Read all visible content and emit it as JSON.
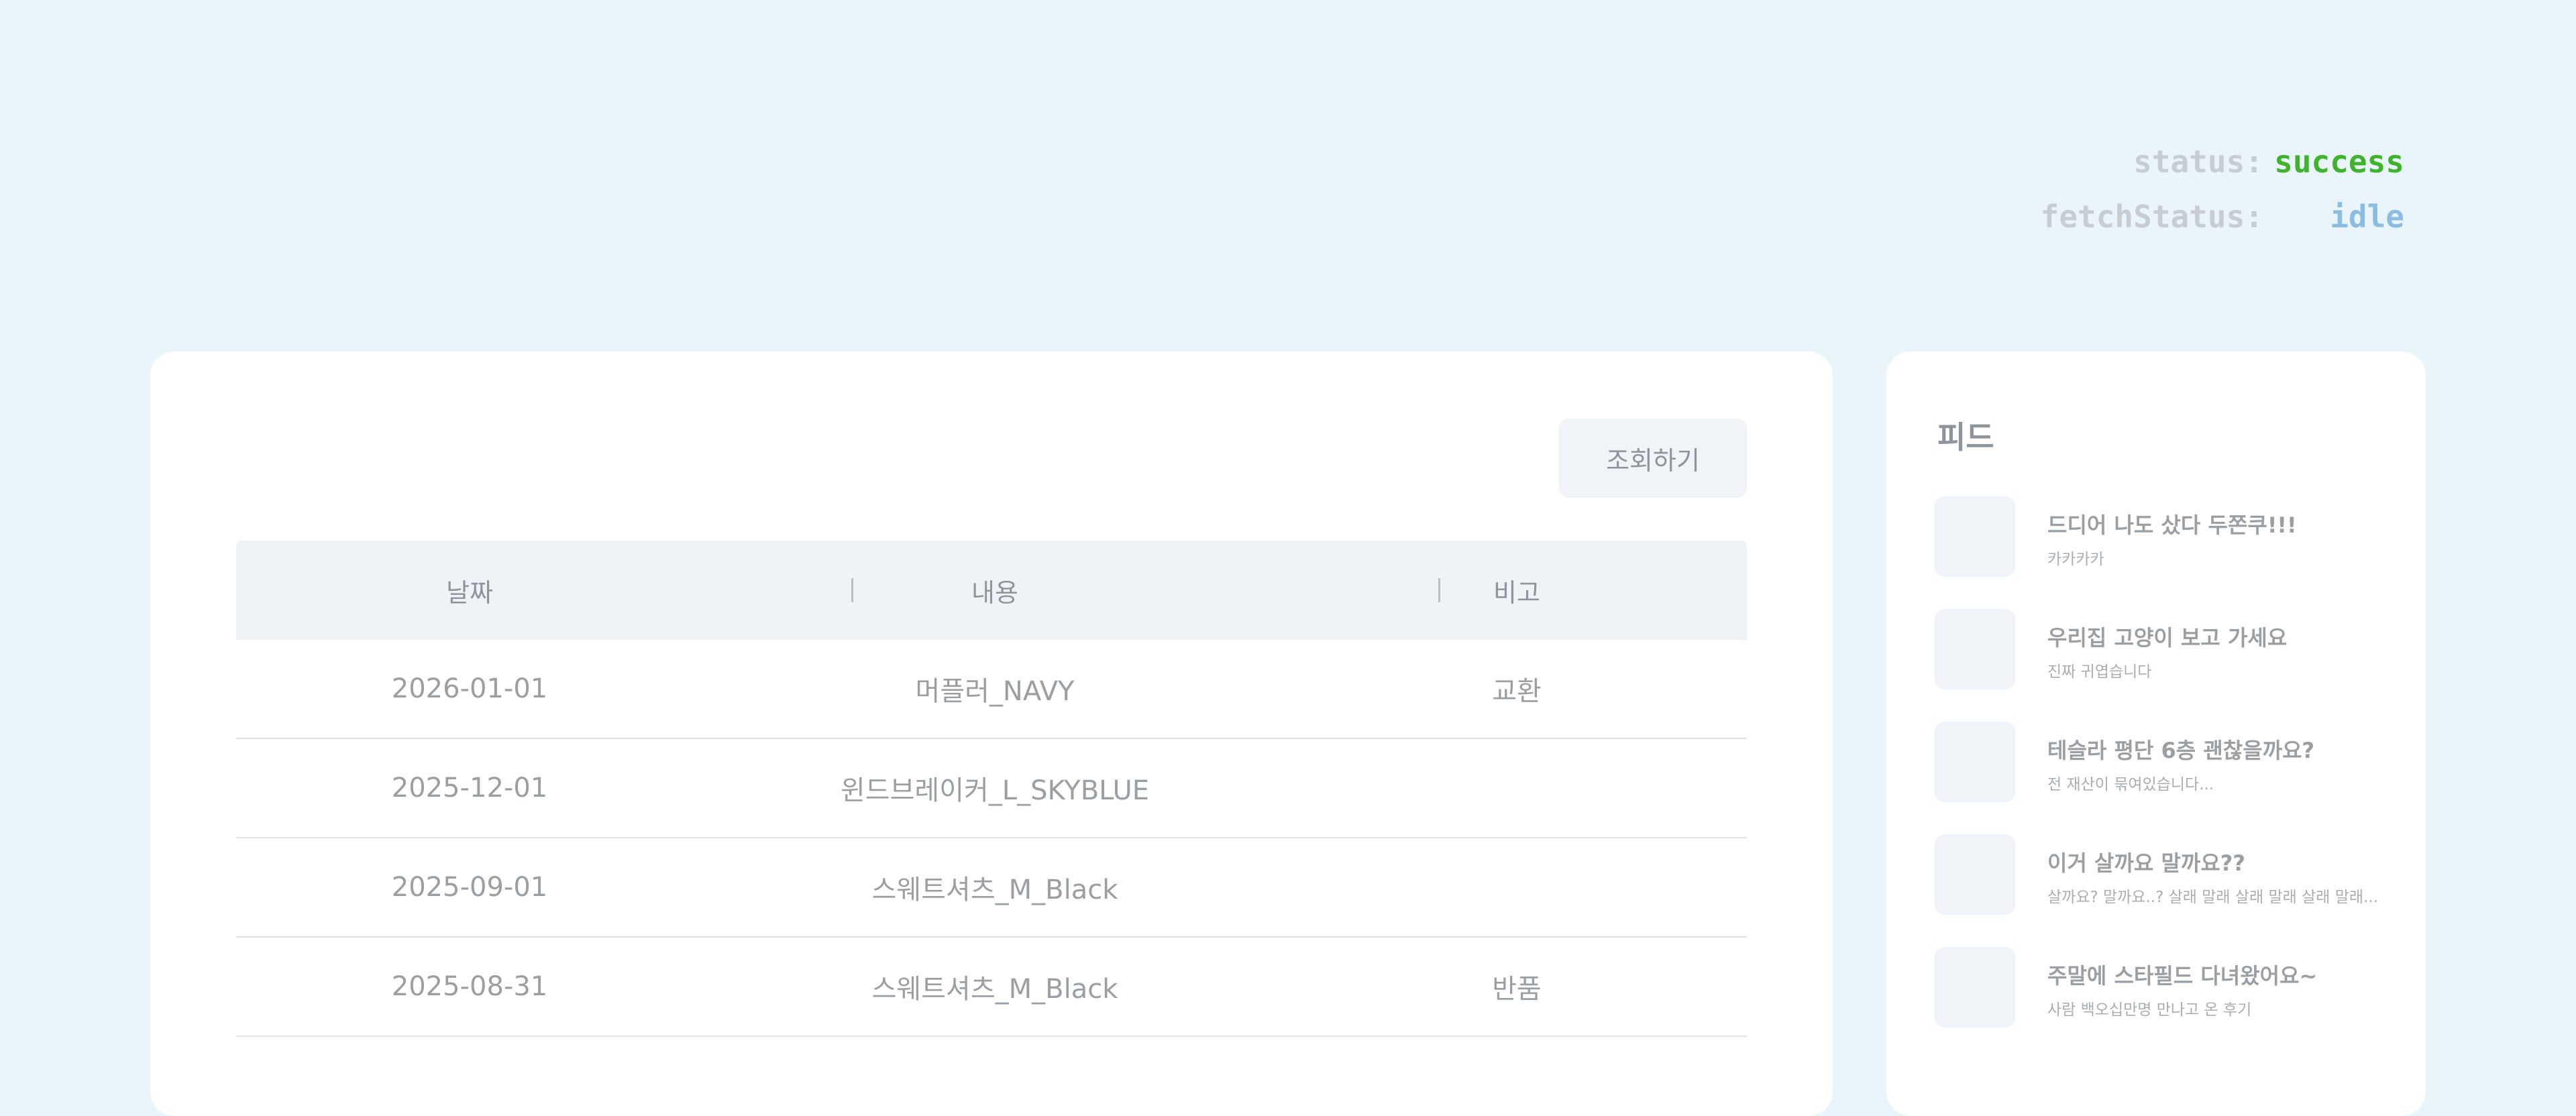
{
  "status": {
    "status_label": "status:",
    "status_value": "success",
    "fetch_label": "fetchStatus:",
    "fetch_value": "idle",
    "colors": {
      "success": "#3fb32a",
      "idle": "#8bbde2"
    }
  },
  "main": {
    "query_button_label": "조회하기",
    "table": {
      "headers": [
        "날짜",
        "내용",
        "비고"
      ],
      "rows": [
        [
          "2026-01-01",
          "머플러_NAVY",
          "교환"
        ],
        [
          "2025-12-01",
          "윈드브레이커_L_SKYBLUE",
          ""
        ],
        [
          "2025-09-01",
          "스웨트셔츠_M_Black",
          ""
        ],
        [
          "2025-08-31",
          "스웨트셔츠_M_Black",
          "반품"
        ]
      ]
    }
  },
  "feed": {
    "title": "피드",
    "items": [
      {
        "title": "드디어 나도 샀다 두쫀쿠!!!",
        "subtitle": "카카카카"
      },
      {
        "title": "우리집 고양이 보고 가세요",
        "subtitle": "진짜 귀엽습니다"
      },
      {
        "title": "테슬라 평단 6층 괜찮을까요?",
        "subtitle": "전 재산이 묶여있습니다..."
      },
      {
        "title": "이거 살까요 말까요??",
        "subtitle": "살까요? 말까요..? 살래 말래 살래 말래 살래 말래..."
      },
      {
        "title": "주말에 스타필드 다녀왔어요~",
        "subtitle": "사람 백오십만명 만나고 온 후기"
      }
    ]
  }
}
